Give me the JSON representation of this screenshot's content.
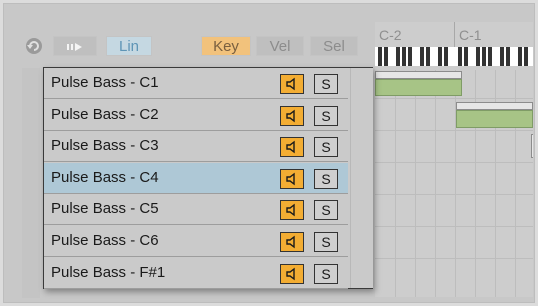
{
  "toolbar": {
    "fold_icon": "refresh-icon",
    "preview_icon": "play-arrows-icon",
    "lin_label": "Lin",
    "key_label": "Key",
    "vel_label": "Vel",
    "sel_label": "Sel"
  },
  "roll": {
    "octave_labels": [
      "C-2",
      "C-1"
    ]
  },
  "lanes": [
    {
      "label": "Pulse Bass - C1",
      "solo": "S",
      "selected": false
    },
    {
      "label": "Pulse Bass - C2",
      "solo": "S",
      "selected": false
    },
    {
      "label": "Pulse Bass - C3",
      "solo": "S",
      "selected": false
    },
    {
      "label": "Pulse Bass - C4",
      "solo": "S",
      "selected": true
    },
    {
      "label": "Pulse Bass - C5",
      "solo": "S",
      "selected": false
    },
    {
      "label": "Pulse Bass - C6",
      "solo": "S",
      "selected": false
    },
    {
      "label": "Pulse Bass - F#1",
      "solo": "S",
      "selected": false
    }
  ],
  "colors": {
    "speaker_active": "#f3ad33",
    "selected_row": "#aec8d6",
    "note": "#a7c486",
    "lin_active": "#c5d8e2",
    "key_active": "#f2c27c"
  }
}
